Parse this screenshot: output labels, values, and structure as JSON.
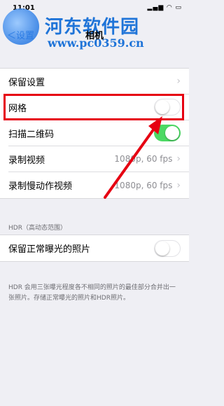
{
  "status_bar": {
    "time": "11:01",
    "icons": "▂▄▆ ◠ ▭"
  },
  "watermark": {
    "title": "河东软件园",
    "url": "www.pc0359.cn"
  },
  "nav": {
    "back": "＜设置",
    "title": "相机"
  },
  "group1": [
    {
      "label": "保留设置",
      "value": "",
      "control": "chevron"
    },
    {
      "label": "网格",
      "value": "",
      "control": "toggle",
      "state": "off"
    },
    {
      "label": "扫描二维码",
      "value": "",
      "control": "toggle",
      "state": "on"
    },
    {
      "label": "录制视频",
      "value": "1080p, 60 fps",
      "control": "chevron"
    },
    {
      "label": "录制慢动作视频",
      "value": "1080p, 60 fps",
      "control": "chevron"
    }
  ],
  "hdr": {
    "header": "HDR（高动态范围）",
    "row_label": "保留正常曝光的照片",
    "row_state": "off",
    "footer": "HDR 会用三张曝光程度各不相同的照片的最佳部分合并出一张照片。存储正常曝光的照片和HDR照片。"
  },
  "chevron": "›",
  "colors": {
    "highlight": "#e60012",
    "toggle_on": "#4cd964",
    "arrow": "#e60012"
  }
}
